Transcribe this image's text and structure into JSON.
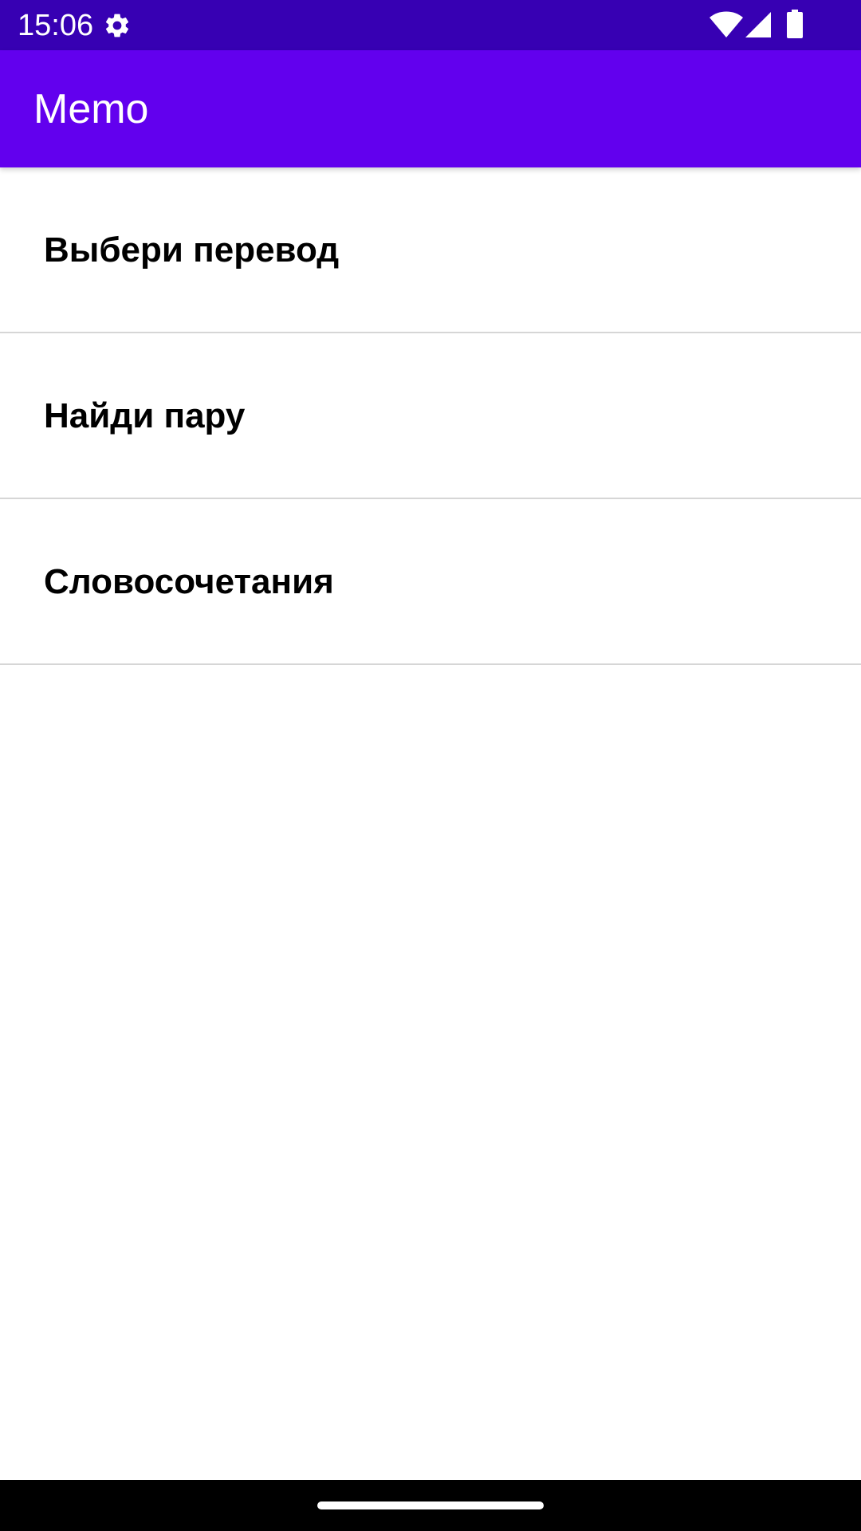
{
  "status_bar": {
    "time": "15:06",
    "icons": [
      "gear-icon",
      "wifi-icon",
      "cell-signal-icon",
      "battery-icon"
    ],
    "background": "#3700b3"
  },
  "app_bar": {
    "title": "Memo",
    "background": "#6200ee"
  },
  "menu": {
    "items": [
      {
        "label": "Выбери перевод"
      },
      {
        "label": "Найди пару"
      },
      {
        "label": "Словосочетания"
      }
    ]
  },
  "nav_bar": {
    "background": "#000000"
  }
}
